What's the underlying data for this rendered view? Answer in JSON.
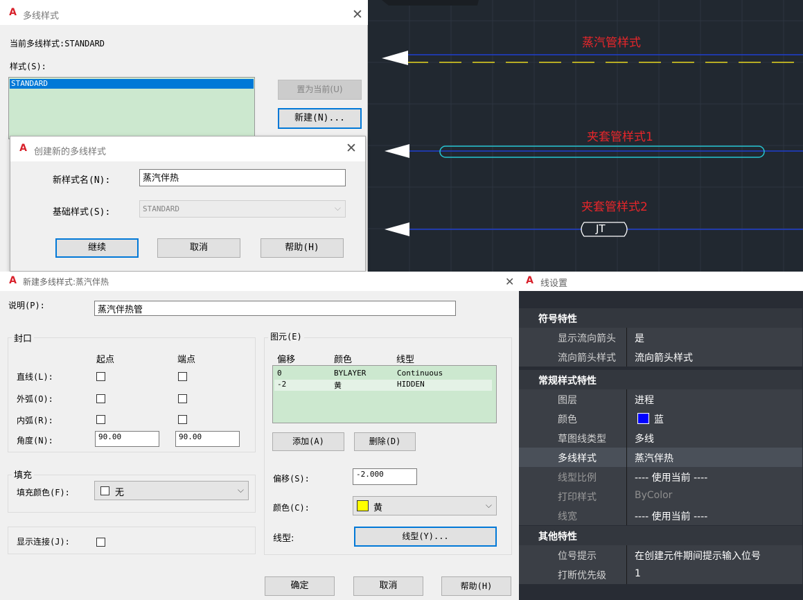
{
  "multiline_style_dialog": {
    "title": "多线样式",
    "current_label": "当前多线样式:STANDARD",
    "styles_label": "样式(S):",
    "styles": [
      "STANDARD"
    ],
    "set_current_button": "置为当前(U)",
    "new_button": "新建(N)..."
  },
  "create_dialog": {
    "title": "创建新的多线样式",
    "name_label": "新样式名(N):",
    "name_value": "蒸汽伴热",
    "base_label": "基础样式(S):",
    "base_value": "STANDARD",
    "continue_button": "继续",
    "cancel_button": "取消",
    "help_button": "帮助(H)"
  },
  "cad_canvas": {
    "labels": [
      "蒸汽管样式",
      "夹套管样式1",
      "夹套管样式2"
    ],
    "jt_label": "JT"
  },
  "new_style_dialog": {
    "title": "新建多线样式:蒸汽伴热",
    "description_label": "说明(P):",
    "description_value": "蒸汽伴热管",
    "caps": {
      "group_label": "封口",
      "start_header": "起点",
      "end_header": "端点",
      "rows": [
        {
          "label": "直线(L):"
        },
        {
          "label": "外弧(O):"
        },
        {
          "label": "内弧(R):"
        }
      ],
      "angle_label": "角度(N):",
      "angle_start": "90.00",
      "angle_end": "90.00"
    },
    "fill": {
      "group_label": "填充",
      "color_label": "填充颜色(F):",
      "color_value": "无"
    },
    "show_joints_label": "显示连接(J):",
    "elements": {
      "group_label": "图元(E)",
      "headers": [
        "偏移",
        "颜色",
        "线型"
      ],
      "rows": [
        {
          "offset": "0",
          "color": "BYLAYER",
          "linetype": "Continuous"
        },
        {
          "offset": "-2",
          "color": "黄",
          "linetype": "HIDDEN"
        }
      ],
      "add_button": "添加(A)",
      "delete_button": "删除(D)",
      "offset_label": "偏移(S):",
      "offset_value": "-2.000",
      "color_label": "颜色(C):",
      "color_value": "黄",
      "color_swatch": "#ffff00",
      "linetype_label": "线型:",
      "linetype_button": "线型(Y)..."
    },
    "ok_button": "确定",
    "cancel_button": "取消",
    "help_button": "帮助(H)"
  },
  "line_settings": {
    "title": "线设置",
    "sections": [
      {
        "title": "符号特性",
        "rows": [
          {
            "label": "显示流向箭头",
            "value": "是"
          },
          {
            "label": "流向箭头样式",
            "value": "流向箭头样式"
          }
        ]
      },
      {
        "title": "常规样式特性",
        "rows": [
          {
            "label": "图层",
            "value": "进程"
          },
          {
            "label": "颜色",
            "value": "蓝"
          },
          {
            "label": "草图线类型",
            "value": "多线"
          },
          {
            "label": "多线样式",
            "value": "蒸汽伴热"
          },
          {
            "label": "线型比例",
            "value": "---- 使用当前 ----"
          },
          {
            "label": "打印样式",
            "value": "ByColor"
          },
          {
            "label": "线宽",
            "value": "---- 使用当前 ----"
          }
        ]
      },
      {
        "title": "其他特性",
        "rows": [
          {
            "label": "位号提示",
            "value": "在创建元件期间提示输入位号"
          },
          {
            "label": "打断优先级",
            "value": "1"
          }
        ]
      }
    ]
  },
  "colors": {
    "list_bg": "#cce8cf",
    "selection": "#0078d7",
    "cad_bg": "#212830",
    "cad_label": "#e8262a",
    "accent": "#0078d7"
  }
}
